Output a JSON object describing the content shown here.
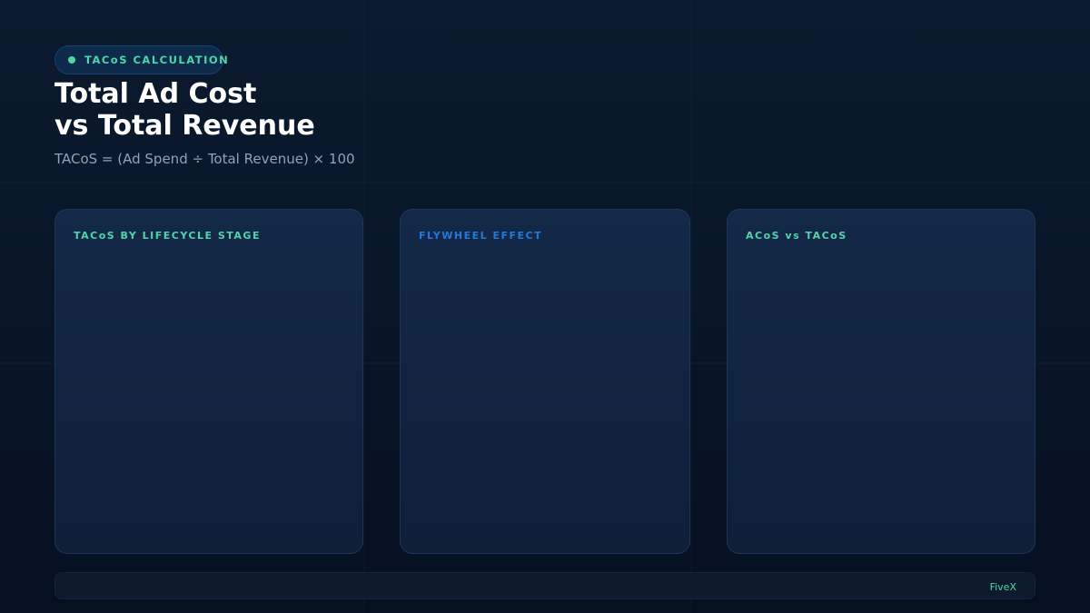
{
  "header": {
    "badge_label": "TACoS CALCULATION",
    "title_line1": "Total Ad Cost",
    "title_line2": "vs Total Revenue",
    "formula": "TACoS = (Ad Spend ÷ Total Revenue) × 100"
  },
  "cards": [
    {
      "label": "TACoS BY LIFECYCLE STAGE",
      "accent": "#4fd6a8"
    },
    {
      "label": "FLYWHEEL EFFECT",
      "accent": "#1f7ae0"
    },
    {
      "label": "ACoS vs TACoS",
      "accent": "#4fd6a8"
    }
  ],
  "footer": {
    "brand": "FiveX"
  },
  "colors": {
    "background": "#081628",
    "accent_green": "#4fd6a8",
    "accent_blue": "#1f7ae0",
    "card_bg": "#12284a",
    "subtitle": "#8fa3bd"
  }
}
